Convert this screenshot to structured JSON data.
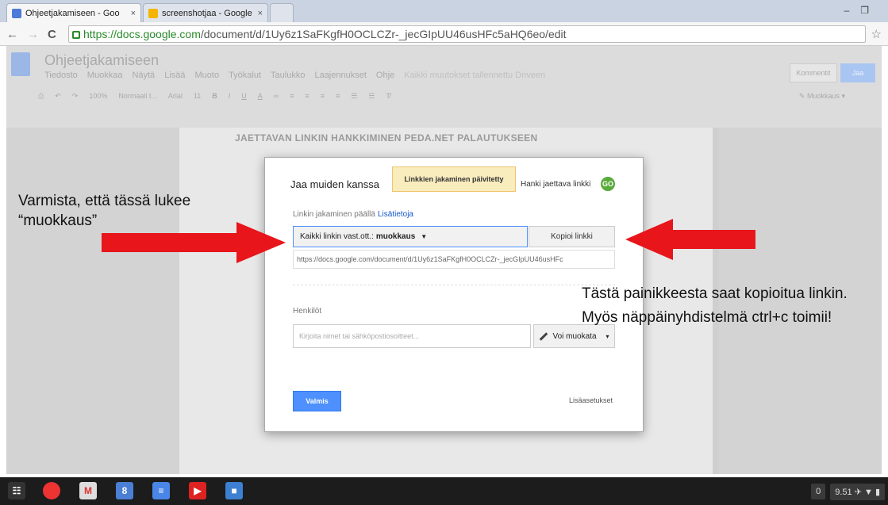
{
  "browser": {
    "tabs": [
      {
        "title": "Ohjeetjakamiseen - Goo",
        "close": "×",
        "favicon_color": "#4d7ad6"
      },
      {
        "title": "screenshotjaa - Google S",
        "close": "×",
        "favicon_color": "#f4b400"
      }
    ],
    "url_scheme_host": "https://docs.google.com",
    "url_path": "/document/d/1Uy6z1SaFKgfH0OCLCZr-_jecGIpUU46usHFc5aHQ6eo/edit"
  },
  "docs": {
    "title": "Ohjeetjakamiseen",
    "menus": [
      "Tiedosto",
      "Muokkaa",
      "Näytä",
      "Lisää",
      "Muoto",
      "Työkalut",
      "Taulukko",
      "Laajennukset",
      "Ohje"
    ],
    "saved_status": "Kaikki muutokset tallennettu Driveen",
    "comments_label": "Kommentit",
    "share_label": "Jaa",
    "toolbar": {
      "zoom": "100%",
      "style": "Normaali t...",
      "font": "Arial",
      "size": "11"
    },
    "edit_mode": "Muokkaus",
    "document_heading": "JAETTAVAN LINKIN HANKKIMINEN PEDA.NET PALAUTUKSEEN"
  },
  "dialog": {
    "title": "Jaa muiden kanssa",
    "notice": "Linkkien jakaminen päivitetty",
    "get_link": "Hanki jaettava linkki",
    "link_status": "Linkin jakaminen päällä",
    "learn_more": "Lisätietoja",
    "access_prefix": "Kaikki linkin vast.ott.:",
    "access_level": "muokkaus",
    "copy_link": "Kopioi linkki",
    "share_url": "https://docs.google.com/document/d/1Uy6z1SaFKgfH0OCLCZr-_jecGIpUU46usHFc",
    "people_label": "Henkilöt",
    "people_placeholder": "Kirjoita nimet tai sähköpostiosoitteet...",
    "permission": "Voi muokata",
    "done": "Valmis",
    "advanced": "Lisäasetukset"
  },
  "annotations": {
    "left_line1": "Varmista, että tässä lukee",
    "left_line2": "“muokkaus”",
    "right_line1": "Tästä painikkeesta saat kopioitua linkin.",
    "right_line2": "Myös näppäinyhdistelmä ctrl+c toimii!",
    "arrow_color": "#e8151b"
  },
  "taskbar": {
    "notification_count": "0",
    "clock": "9.51"
  }
}
